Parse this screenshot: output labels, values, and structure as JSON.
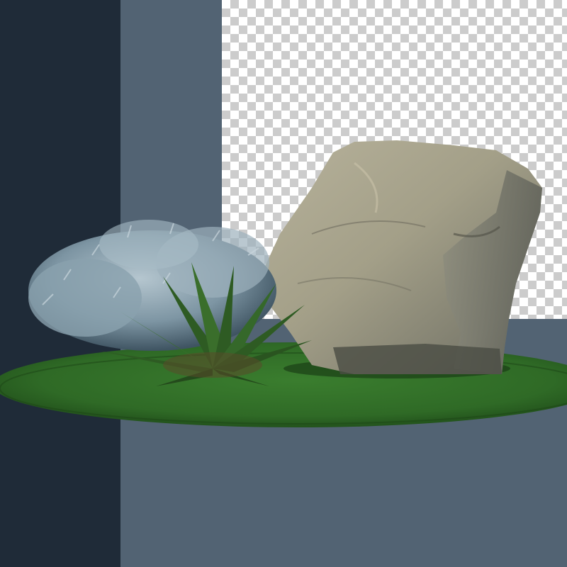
{
  "colors": {
    "dark_panel": "#1f2b38",
    "mid_panel": "#526373",
    "checker_light": "#ffffff",
    "checker_dark": "#cccccc",
    "grass": "#2f6a26",
    "grass_dark": "#1e4a18",
    "rock": "#9c9a86",
    "rock_shadow": "#5e5d52",
    "shrub": "#7d95a3",
    "fern": "#2e5b23"
  },
  "scene": {
    "objects": [
      "grass-patch",
      "rock",
      "silver-shrub",
      "fern-plant"
    ]
  }
}
